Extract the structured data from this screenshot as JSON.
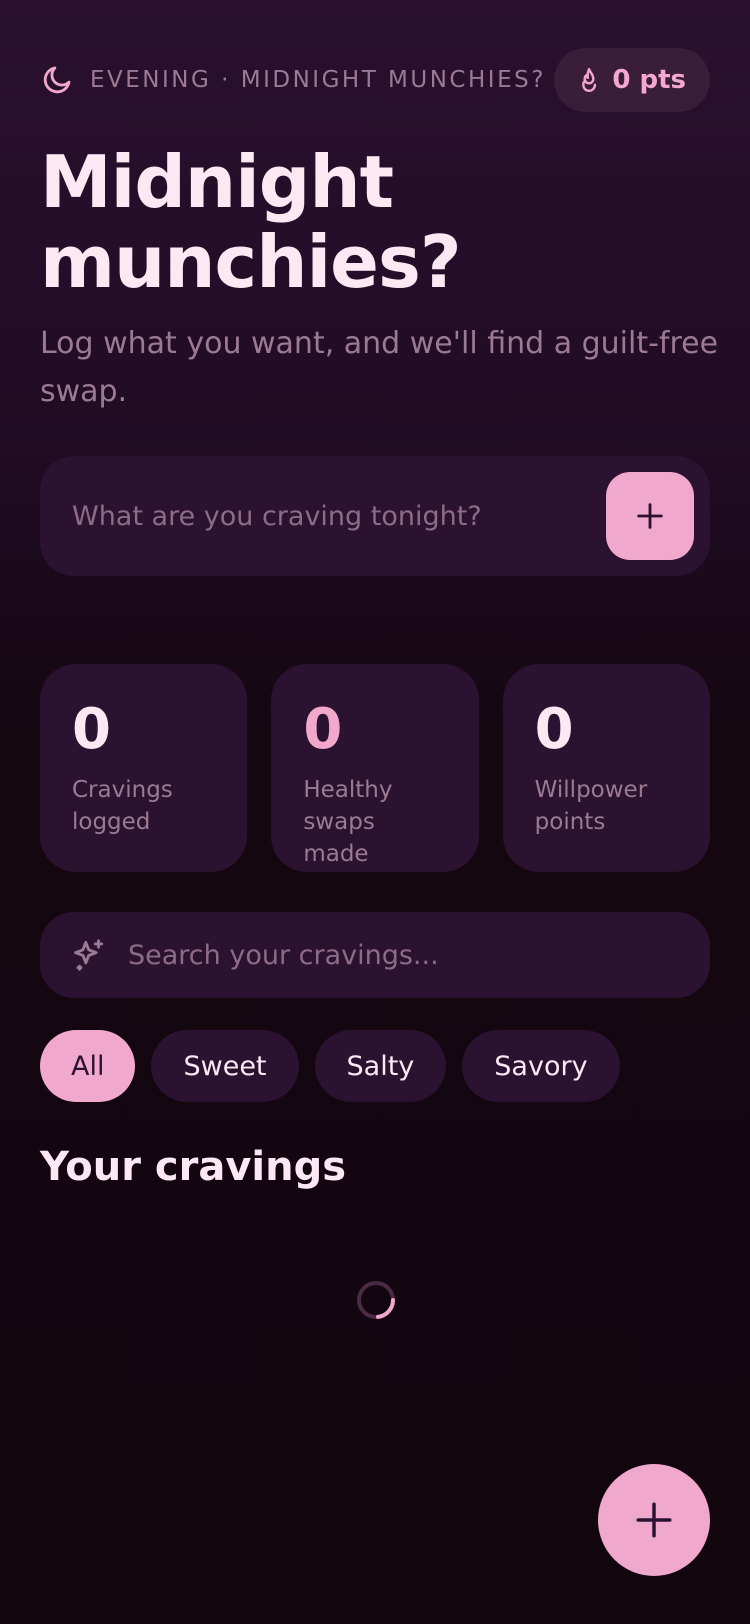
{
  "header": {
    "greeting": "EVENING · MIDNIGHT MUNCHIES?",
    "points": "0 pts",
    "moon_icon": "moon-icon",
    "flame_icon": "flame-icon"
  },
  "hero": {
    "title_line1": "Midnight",
    "title_line2": "munchies?",
    "subtitle": "Log what you want, and we'll find a guilt-free swap."
  },
  "craving_input": {
    "placeholder": "What are you craving tonight?",
    "value": "",
    "add_icon": "plus-icon"
  },
  "stats": [
    {
      "value": "0",
      "label": "Cravings logged",
      "color": "#fbe8f3"
    },
    {
      "value": "0",
      "label": "Healthy swaps made",
      "color": "#f0a8cc"
    },
    {
      "value": "0",
      "label": "Willpower points",
      "color": "#fbe8f3"
    }
  ],
  "search": {
    "placeholder": "Search your cravings...",
    "value": "",
    "icon": "sparkle-icon"
  },
  "filters": [
    {
      "label": "All",
      "active": true
    },
    {
      "label": "Sweet",
      "active": false
    },
    {
      "label": "Salty",
      "active": false
    },
    {
      "label": "Savory",
      "active": false
    }
  ],
  "list": {
    "title": "Your cravings",
    "state": "loading"
  },
  "fab": {
    "icon": "plus-icon"
  },
  "colors": {
    "accent": "#f0a8cc",
    "background": "#12060f",
    "card": "#2b1230",
    "muted_text": "#9c7a93",
    "text": "#fbe8f3"
  }
}
